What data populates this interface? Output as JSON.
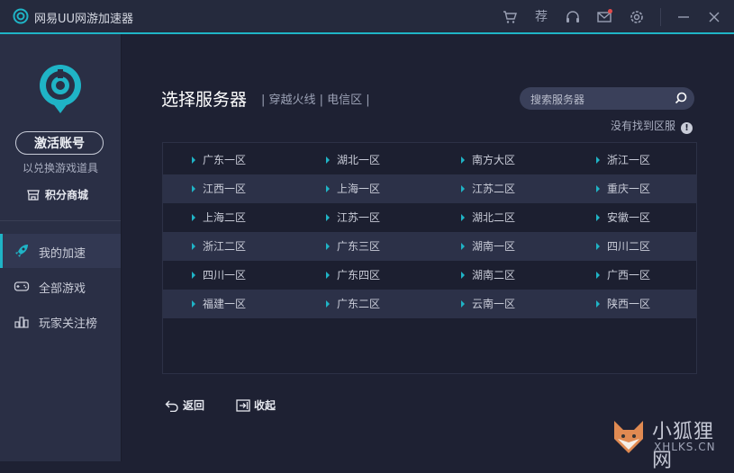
{
  "app": {
    "title": "网易UU网游加速器"
  },
  "titlebar_icons": [
    "cart-icon",
    "recommend-icon",
    "headset-icon",
    "mail-icon",
    "settings-icon",
    "minimize-icon",
    "close-icon"
  ],
  "titlebar": {
    "recommend_glyph": "荐"
  },
  "sidebar": {
    "activate_label": "激活账号",
    "activate_sub": "以兑换游戏道具",
    "shop_label": "积分商城",
    "nav": [
      {
        "label": "我的加速",
        "icon": "rocket-icon",
        "active": true
      },
      {
        "label": "全部游戏",
        "icon": "gamepad-icon",
        "active": false
      },
      {
        "label": "玩家关注榜",
        "icon": "ranking-icon",
        "active": false
      }
    ]
  },
  "main": {
    "title": "选择服务器",
    "breadcrumb": "| 穿越火线 | 电信区 |",
    "search_placeholder": "搜索服务器",
    "not_found": "没有找到区服",
    "not_found_icon": "!",
    "servers": [
      [
        "广东一区",
        "湖北一区",
        "南方大区",
        "浙江一区"
      ],
      [
        "江西一区",
        "上海一区",
        "江苏二区",
        "重庆一区"
      ],
      [
        "上海二区",
        "江苏一区",
        "湖北二区",
        "安徽一区"
      ],
      [
        "浙江二区",
        "广东三区",
        "湖南一区",
        "四川二区"
      ],
      [
        "四川一区",
        "广东四区",
        "湖南二区",
        "广西一区"
      ],
      [
        "福建一区",
        "广东二区",
        "云南一区",
        "陕西一区"
      ]
    ],
    "back_label": "返回",
    "collapse_label": "收起"
  },
  "watermark": {
    "title": "小狐狸网",
    "domain": "XHLKS.CN"
  },
  "colors": {
    "accent": "#1fb4c6",
    "background": "#1e2133",
    "sidebar": "#2a2f45",
    "row_alt": "#2c3148"
  }
}
